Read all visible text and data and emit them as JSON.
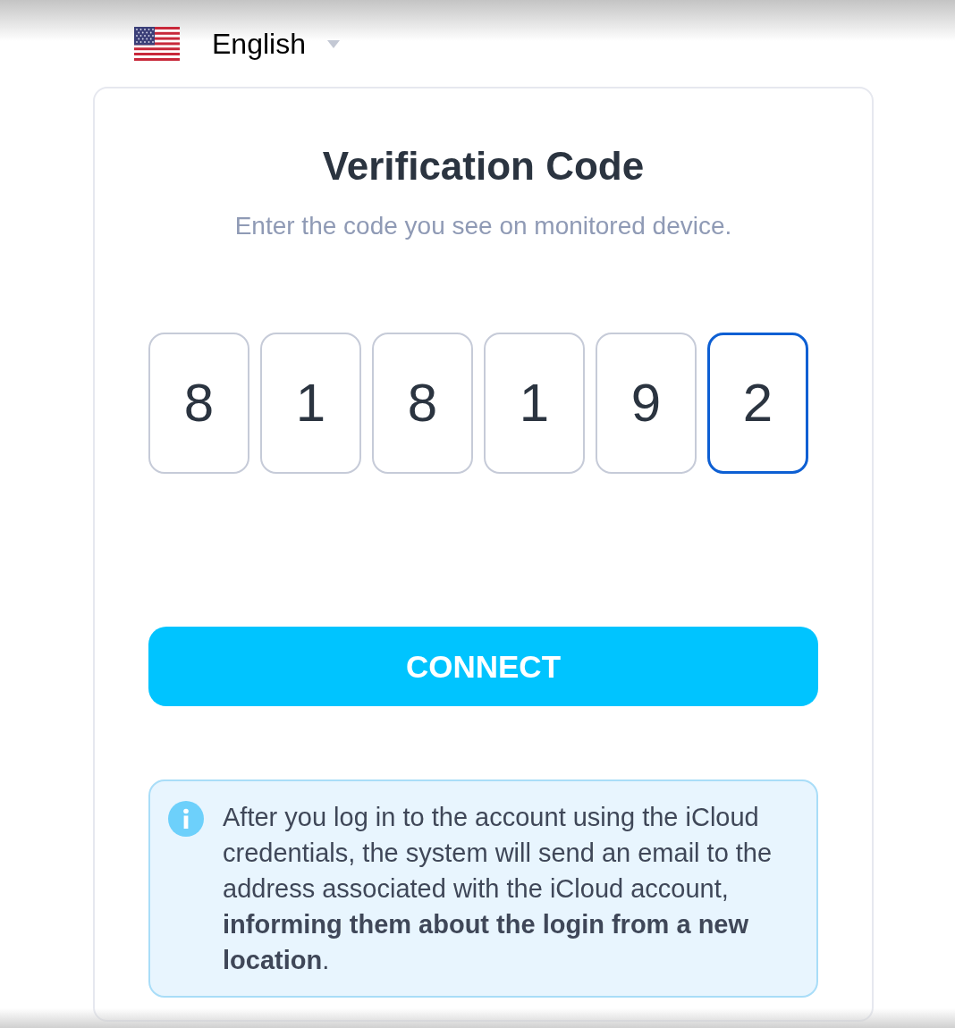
{
  "language_selector": {
    "label": "English"
  },
  "card": {
    "title": "Verification Code",
    "subtitle": "Enter the code you see on monitored device.",
    "code_digits": [
      {
        "value": "8",
        "selected": false
      },
      {
        "value": "1",
        "selected": false
      },
      {
        "value": "8",
        "selected": false
      },
      {
        "value": "1",
        "selected": false
      },
      {
        "value": "9",
        "selected": false
      },
      {
        "value": "2",
        "selected": true
      }
    ],
    "connect_button": {
      "label": "CONNECT"
    },
    "info_note": {
      "text": "After you log in to the account using the iCloud credentials, the system will send an email to the address associated with the iCloud account, **informing them about the login from a new location**."
    }
  }
}
